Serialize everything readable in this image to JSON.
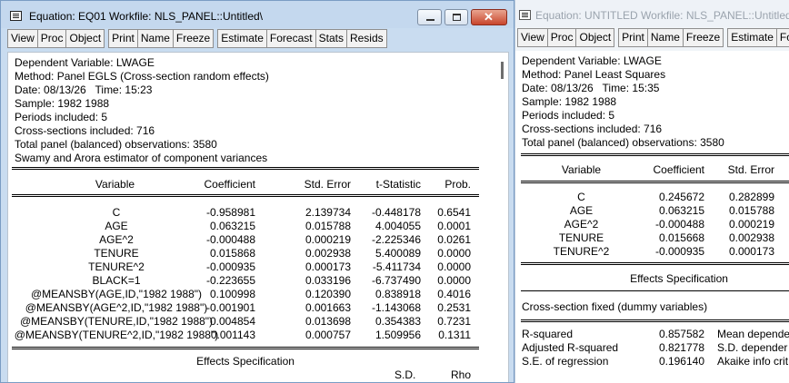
{
  "window1": {
    "title": "Equation: EQ01   Workfile: NLS_PANEL::Untitled\\",
    "buttons": {
      "minimize": "minimize",
      "maximize": "maximize",
      "close": "✕"
    },
    "toolbar": [
      "View",
      "Proc",
      "Object",
      "Print",
      "Name",
      "Freeze",
      "Estimate",
      "Forecast",
      "Stats",
      "Resids"
    ],
    "header_lines": [
      "Dependent Variable: LWAGE",
      "Method: Panel EGLS (Cross-section random effects)",
      "Date: 08/13/26   Time: 15:23",
      "Sample: 1982 1988",
      "Periods included: 5",
      "Cross-sections included: 716",
      "Total panel (balanced) observations: 3580",
      "Swamy and Arora estimator of component variances"
    ],
    "columns": [
      "Variable",
      "Coefficient",
      "Std. Error",
      "t-Statistic",
      "Prob."
    ],
    "rows": [
      [
        "C",
        "-0.958981",
        "2.139734",
        "-0.448178",
        "0.6541"
      ],
      [
        "AGE",
        "0.063215",
        "0.015788",
        "4.004055",
        "0.0001"
      ],
      [
        "AGE^2",
        "-0.000488",
        "0.000219",
        "-2.225346",
        "0.0261"
      ],
      [
        "TENURE",
        "0.015868",
        "0.002938",
        "5.400089",
        "0.0000"
      ],
      [
        "TENURE^2",
        "-0.000935",
        "0.000173",
        "-5.411734",
        "0.0000"
      ],
      [
        "BLACK=1",
        "-0.223655",
        "0.033196",
        "-6.737490",
        "0.0000"
      ],
      [
        "@MEANSBY(AGE,ID,\"1982 1988\")",
        "0.100998",
        "0.120390",
        "0.838918",
        "0.4016"
      ],
      [
        "@MEANSBY(AGE^2,ID,\"1982 1988\")",
        "-0.001901",
        "0.001663",
        "-1.143068",
        "0.2531"
      ],
      [
        "@MEANSBY(TENURE,ID,\"1982 1988\")",
        "0.004854",
        "0.013698",
        "0.354383",
        "0.7231"
      ],
      [
        "@MEANSBY(TENURE^2,ID,\"1982 1988\")",
        "0.001143",
        "0.000757",
        "1.509956",
        "0.1311"
      ]
    ],
    "effects_title": "Effects Specification",
    "effects_cols": [
      "S.D.",
      "Rho"
    ]
  },
  "window2": {
    "title": "Equation: UNTITLED   Workfile: NLS_PANEL::Untitled",
    "toolbar": [
      "View",
      "Proc",
      "Object",
      "Print",
      "Name",
      "Freeze",
      "Estimate",
      "Fore"
    ],
    "header_lines": [
      "Dependent Variable: LWAGE",
      "Method: Panel Least Squares",
      "Date: 08/13/26   Time: 15:35",
      "Sample: 1982 1988",
      "Periods included: 5",
      "Cross-sections included: 716",
      "Total panel (balanced) observations: 3580"
    ],
    "columns": [
      "Variable",
      "Coefficient",
      "Std. Error"
    ],
    "rows": [
      [
        "C",
        "0.245672",
        "0.282899"
      ],
      [
        "AGE",
        "0.063215",
        "0.015788"
      ],
      [
        "AGE^2",
        "-0.000488",
        "0.000219"
      ],
      [
        "TENURE",
        "0.015668",
        "0.002938"
      ],
      [
        "TENURE^2",
        "-0.000935",
        "0.000173"
      ]
    ],
    "effects_title": "Effects Specification",
    "effects_line": "Cross-section fixed (dummy variables)",
    "stats": [
      [
        "R-squared",
        "0.857582",
        "Mean depende"
      ],
      [
        "Adjusted R-squared",
        "0.821778",
        "S.D. depender"
      ],
      [
        "S.E. of regression",
        "0.196140",
        "Akaike info crit"
      ]
    ]
  }
}
